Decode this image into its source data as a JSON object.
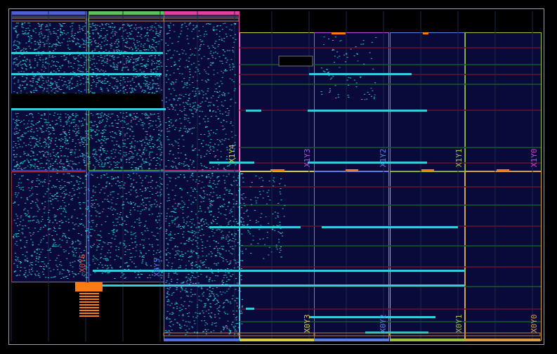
{
  "device_view": {
    "background": "#000000",
    "fabric_fill": "#0a0a3a",
    "grid_line": "#1c2a4a",
    "route_color": "#32cbe0",
    "route_dim_color": "#1ea8c0",
    "row_band_red": "#6a1028",
    "row_band_green": "#0f5a2a",
    "io_bank_orange": "#ff7a10",
    "clock_regions": [
      {
        "name": "X0Y6",
        "label": "X0Y6",
        "color": "#e05050"
      },
      {
        "name": "X0Y5",
        "label": "X0Y5",
        "color": "#5070e0"
      },
      {
        "name": "X1Y4",
        "label": "X1Y4",
        "color": "#d8d040"
      },
      {
        "name": "X1Y3",
        "label": "X1Y3",
        "color": "#b050e0"
      },
      {
        "name": "X1Y2",
        "label": "X1Y2",
        "color": "#6080e0"
      },
      {
        "name": "X1Y1",
        "label": "X1Y1",
        "color": "#a0c040"
      },
      {
        "name": "X1Y0",
        "label": "X1Y0",
        "color": "#d040d0"
      },
      {
        "name": "X0Y3",
        "label": "X0Y3",
        "color": "#d8d040"
      },
      {
        "name": "X0Y2",
        "label": "X0Y2",
        "color": "#6080e0"
      },
      {
        "name": "X0Y1",
        "label": "X0Y1",
        "color": "#a0c040"
      },
      {
        "name": "X0Y0",
        "label": "X0Y0",
        "color": "#d8a040"
      }
    ],
    "top_region_colors": [
      "#5060d0",
      "#60c060",
      "#e040a0"
    ]
  }
}
